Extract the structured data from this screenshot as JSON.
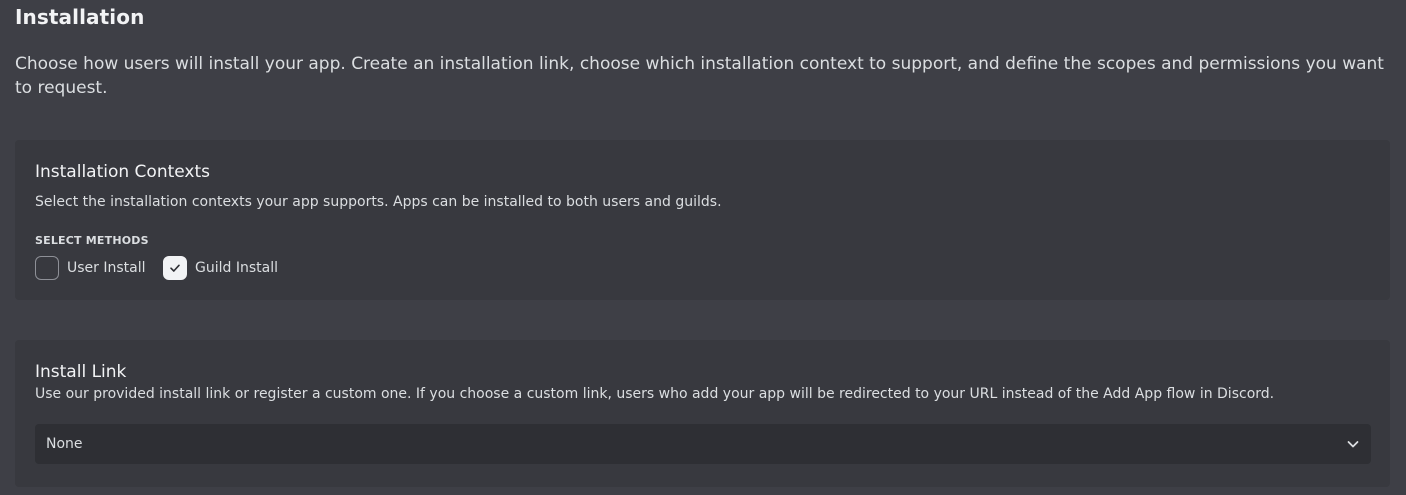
{
  "page": {
    "title": "Installation",
    "description": "Choose how users will install your app. Create an installation link, choose which installation context to support, and define the scopes and permissions you want to request."
  },
  "installation_contexts": {
    "title": "Installation Contexts",
    "description": "Select the installation contexts your app supports. Apps can be installed to both users and guilds.",
    "section_label": "SELECT METHODS",
    "options": [
      {
        "label": "User Install",
        "checked": false,
        "icon": "empty-checkbox-icon"
      },
      {
        "label": "Guild Install",
        "checked": true,
        "icon": "checkmark-icon"
      }
    ]
  },
  "install_link": {
    "title": "Install Link",
    "description": "Use our provided install link or register a custom one. If you choose a custom link, users who add your app will be redirected to your URL instead of the Add App flow in Discord.",
    "selected_value": "None",
    "dropdown_icon": "chevron-down-icon"
  },
  "colors": {
    "background": "#3e3f46",
    "card": "#38393f",
    "input": "#2e2f34",
    "text": "#dbdee1",
    "heading": "#f2f3f5"
  }
}
